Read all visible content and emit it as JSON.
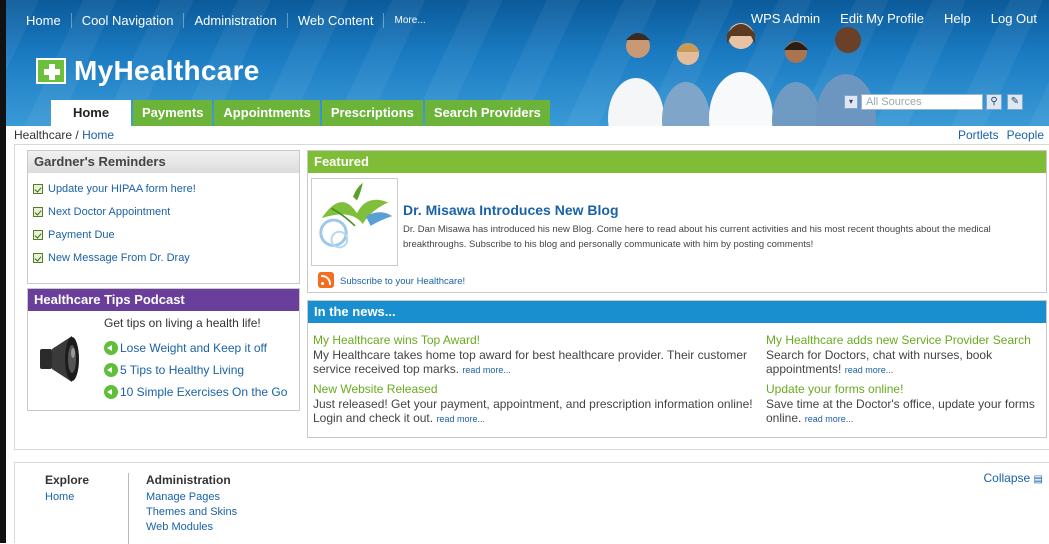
{
  "topnav": {
    "items": [
      "Home",
      "Cool Navigation",
      "Administration",
      "Web Content"
    ],
    "more": "More..."
  },
  "usernav": {
    "admin": "WPS Admin",
    "profile": "Edit My Profile",
    "help": "Help",
    "logout": "Log Out"
  },
  "brand": {
    "name": "MyHealthcare"
  },
  "tabs": [
    "Home",
    "Payments",
    "Appointments",
    "Prescriptions",
    "Search Providers"
  ],
  "search": {
    "placeholder": "All Sources"
  },
  "breadcrumb": {
    "root": "Healthcare",
    "sep": "/",
    "current": "Home"
  },
  "page_links": {
    "portlets": "Portlets",
    "people": "People"
  },
  "reminders": {
    "title": "Gardner's Reminders",
    "items": [
      "Update your HIPAA form here!",
      "Next Doctor Appointment",
      "Payment Due",
      "New Message From Dr. Dray"
    ]
  },
  "podcast": {
    "title": "Healthcare Tips Podcast",
    "intro": "Get tips on living a health life!",
    "links": [
      "Lose Weight and Keep it off",
      "5 Tips to Healthy Living",
      "10 Simple Exercises On the Go"
    ]
  },
  "featured": {
    "header": "Featured",
    "title": "Dr. Misawa Introduces New Blog",
    "desc": "Dr. Dan Misawa has introduced his new Blog. Come here to read about his current activities and his most recent thoughts about the medical breakthroughs. Subscribe to his blog and personally communicate with him by posting comments!",
    "subscribe": "Subscribe to your Healthcare!"
  },
  "news": {
    "header": "In the news...",
    "read_more": "read more...",
    "items": [
      {
        "title": "My Healthcare wins Top Award!",
        "text": "My Healthcare takes home top award for best healthcare provider. Their customer service received top marks."
      },
      {
        "title": "New Website Released",
        "text": "Just released! Get your payment, appointment, and prescription information online! Login and check it out."
      },
      {
        "title": "My Healthcare adds new Service Provider Search",
        "text": "Search for Doctors, chat with nurses, book appointments!"
      },
      {
        "title": "Update your forms online!",
        "text": "Save time at the Doctor's office, update your forms online."
      }
    ]
  },
  "footer": {
    "explore": {
      "title": "Explore",
      "links": [
        "Home"
      ]
    },
    "admin": {
      "title": "Administration",
      "links": [
        "Manage Pages",
        "Themes and Skins",
        "Web Modules"
      ]
    },
    "collapse": "Collapse"
  }
}
